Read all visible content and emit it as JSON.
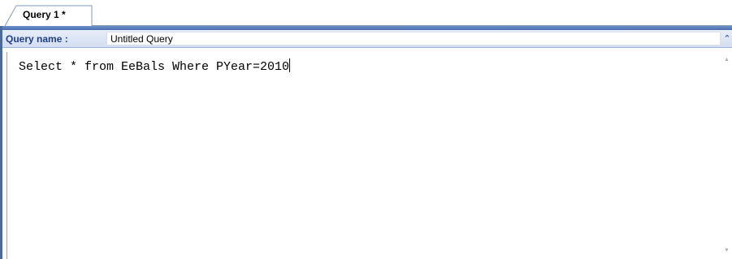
{
  "tabs": [
    {
      "label": "Query 1 *",
      "active": true
    }
  ],
  "query_name_bar": {
    "label": "Query name :",
    "value": "Untitled Query"
  },
  "editor": {
    "text": "Select * from EeBals Where PYear=2010"
  },
  "icons": {
    "collapse": "double-chevron-up-icon",
    "scroll_up": "scroll-up-arrow-icon",
    "scroll_down": "scroll-down-arrow-icon"
  },
  "colors": {
    "frame_border": "#4a6b9c",
    "bar_background": "#d3def1",
    "label_text": "#1f3f8f"
  }
}
